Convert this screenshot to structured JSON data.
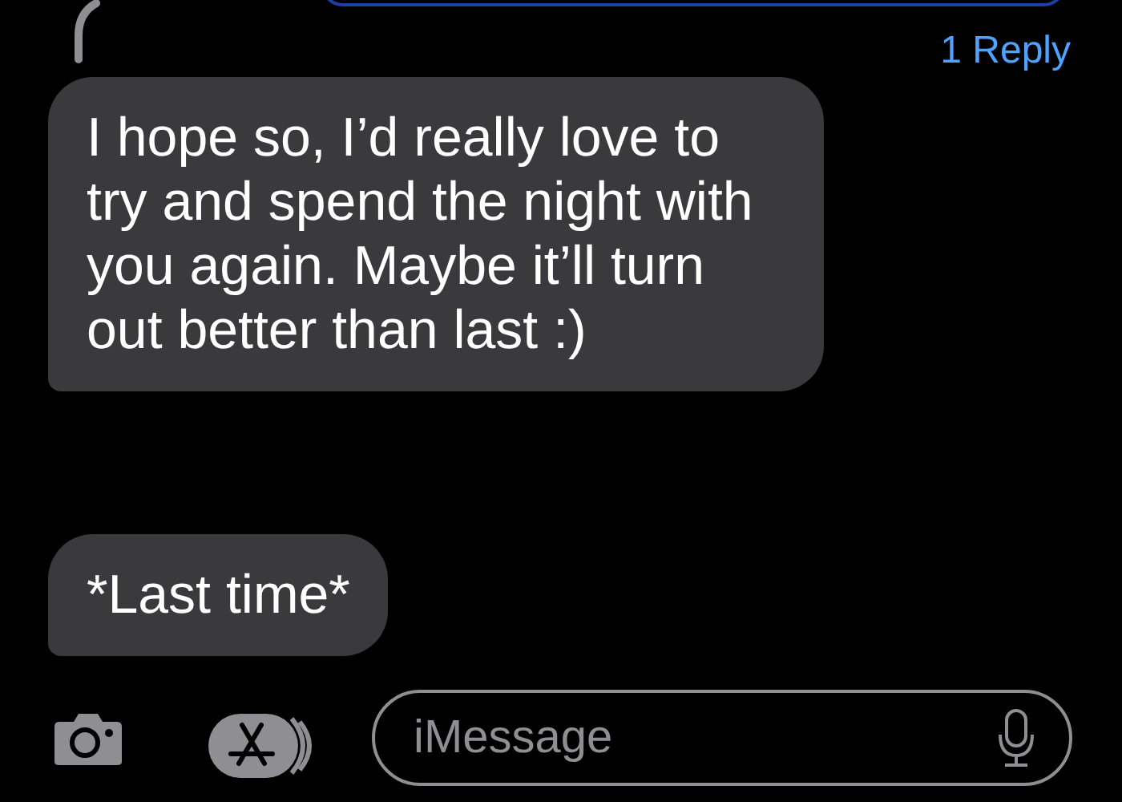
{
  "thread": {
    "reply_label": "1 Reply"
  },
  "messages": [
    {
      "text": "I hope so, I’d really love to try and spend the night with you again. Maybe it’ll turn out better than last :)"
    },
    {
      "text": "*Last time*"
    }
  ],
  "composer": {
    "placeholder": "iMessage"
  }
}
